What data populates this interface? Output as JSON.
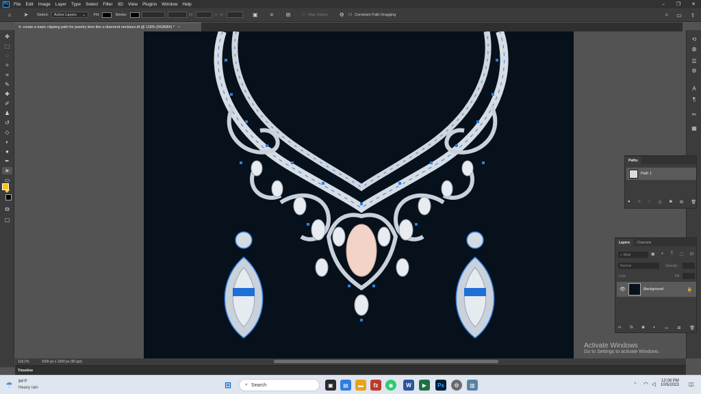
{
  "app": {
    "logo": "Ps"
  },
  "menu": [
    "File",
    "Edit",
    "Image",
    "Layer",
    "Type",
    "Select",
    "Filter",
    "3D",
    "View",
    "Plugins",
    "Window",
    "Help"
  ],
  "options": {
    "select_label": "Select:",
    "select_value": "Active Layers",
    "fill_label": "Fill:",
    "stroke_label": "Stroke:",
    "w_label": "W:",
    "h_label": "H:",
    "align_edges": "Align Edges",
    "constrain": "Constrain Path Dragging"
  },
  "document": {
    "tab_title": "4. create a basic clipping path for jewelry item like a diamond necklace.tif @ 118% (RGB/8#) *"
  },
  "status": {
    "zoom": "118.1%",
    "doc_size": "1000 px x 1000 px (96 ppi)"
  },
  "timeline": {
    "label": "Timeline"
  },
  "paths_panel": {
    "tab": "Paths",
    "item": "Path 1"
  },
  "layers_panel": {
    "tabs": [
      "Layers",
      "Channels"
    ],
    "kind_placeholder": "Kind",
    "blend_mode": "Normal",
    "opacity_label": "Opacity:",
    "lock_label": "Lock:",
    "fill_label": "Fill:",
    "layer_name": "Background"
  },
  "activate": {
    "title": "Activate Windows",
    "sub": "Go to Settings to activate Windows."
  },
  "taskbar": {
    "weather_temp": "84°F",
    "weather_desc": "Heavy rain",
    "search_label": "Search",
    "time": "12:08 PM",
    "date": "10/5/2023"
  },
  "colors": {
    "canvas_bg": "#07111b",
    "path_blue": "#2f7de0",
    "accent_yellow": "#ffc400"
  }
}
